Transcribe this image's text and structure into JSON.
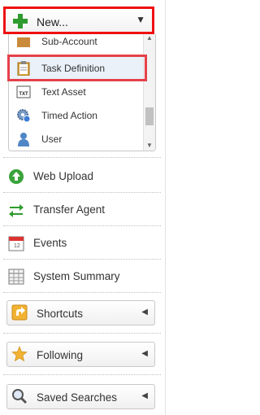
{
  "new_button": {
    "label": "New...",
    "icon": "plus-icon"
  },
  "new_menu": {
    "items": [
      {
        "label": "Sub-Account",
        "icon": "sub-account-icon"
      },
      {
        "label": "Task Definition",
        "icon": "clipboard-icon"
      },
      {
        "label": "Text Asset",
        "icon": "txt-file-icon",
        "icon_text": "TXT"
      },
      {
        "label": "Timed Action",
        "icon": "timed-gear-icon"
      },
      {
        "label": "User",
        "icon": "user-icon"
      }
    ]
  },
  "nav": [
    {
      "label": "Web Upload",
      "icon": "upload-arrow-icon"
    },
    {
      "label": "Transfer Agent",
      "icon": "transfer-arrows-icon"
    },
    {
      "label": "Events",
      "icon": "calendar-icon",
      "icon_text": "12"
    },
    {
      "label": "System Summary",
      "icon": "grid-table-icon"
    }
  ],
  "accordions": [
    {
      "label": "Shortcuts",
      "icon": "shortcut-arrow-icon"
    },
    {
      "label": "Following",
      "icon": "star-icon"
    },
    {
      "label": "Saved Searches",
      "icon": "magnifier-icon"
    }
  ],
  "colors": {
    "highlight_red": "#e11",
    "hover_row": "#eaf1f8",
    "plus_green": "#2e9b2e"
  }
}
